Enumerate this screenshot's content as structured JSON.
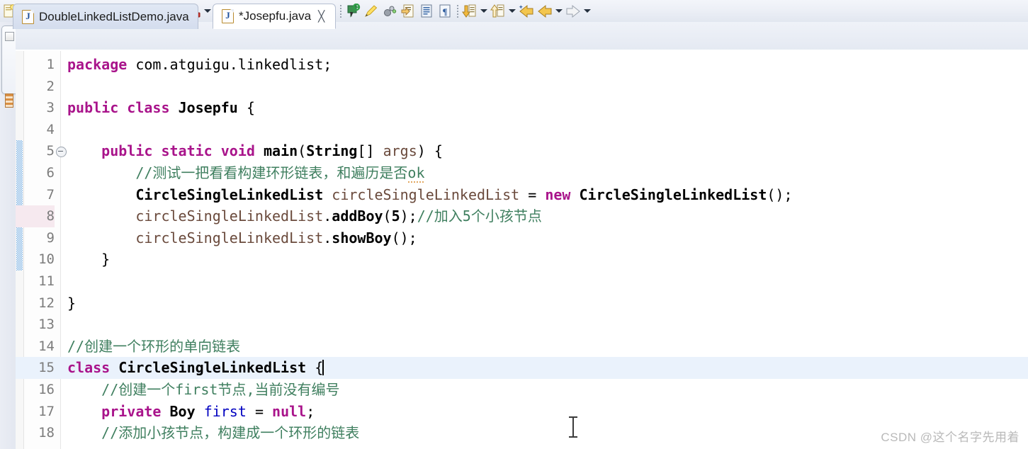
{
  "toolbar": {
    "items": [
      {
        "name": "new-wizard-icon",
        "glyph": "new",
        "dropdown": true
      },
      {
        "sep": true
      },
      {
        "name": "save-icon",
        "glyph": "save",
        "dropdown": false
      },
      {
        "name": "save-all-icon",
        "glyph": "save-all",
        "dropdown": false
      },
      {
        "sep": true
      },
      {
        "name": "console-icon",
        "glyph": "console",
        "dropdown": false
      },
      {
        "sep": true
      },
      {
        "name": "skip-breakpoints-icon",
        "glyph": "skip-bp",
        "dropdown": false
      },
      {
        "sep": true
      },
      {
        "name": "debug-icon",
        "glyph": "debug",
        "dropdown": true
      },
      {
        "name": "run-icon",
        "glyph": "run",
        "dropdown": true
      },
      {
        "name": "run-coverage-icon",
        "glyph": "coverage",
        "dropdown": true
      },
      {
        "sep": true
      },
      {
        "name": "new-java-package-icon",
        "glyph": "package",
        "dropdown": false
      },
      {
        "name": "new-class-icon",
        "glyph": "class",
        "dropdown": true
      },
      {
        "sep": true
      },
      {
        "name": "open-type-icon",
        "glyph": "open-type",
        "dropdown": false
      },
      {
        "name": "open-task-icon",
        "glyph": "open-task",
        "dropdown": false
      },
      {
        "name": "search-icon",
        "glyph": "pencil",
        "dropdown": true
      },
      {
        "sep": true
      },
      {
        "name": "debug-last-icon",
        "glyph": "annotate",
        "dropdown": false
      },
      {
        "name": "marker-icon",
        "glyph": "highlighter",
        "dropdown": false
      },
      {
        "name": "external-tools-icon",
        "glyph": "tools",
        "dropdown": false
      },
      {
        "name": "next-annotation-icon",
        "glyph": "next-edit",
        "dropdown": false
      },
      {
        "name": "show-whitespace-icon",
        "glyph": "whitespace",
        "dropdown": false
      },
      {
        "name": "paragraph-icon",
        "glyph": "paragraph",
        "dropdown": false
      },
      {
        "sep": true
      },
      {
        "name": "next-annotation-down-icon",
        "glyph": "down-annot",
        "dropdown": true
      },
      {
        "name": "previous-annotation-up-icon",
        "glyph": "up-annot",
        "dropdown": true
      },
      {
        "name": "back-to-icon",
        "glyph": "back-star",
        "dropdown": false
      },
      {
        "name": "back-icon",
        "glyph": "back",
        "dropdown": true
      },
      {
        "name": "forward-icon",
        "glyph": "forward",
        "dropdown": true
      }
    ]
  },
  "tabs": [
    {
      "label": "DoubleLinkedListDemo.java",
      "active": false,
      "dirty": false,
      "closable": false
    },
    {
      "label": "*Josepfu.java",
      "active": true,
      "dirty": true,
      "closable": true
    }
  ],
  "editor": {
    "active_line": 15,
    "caret_line": 15,
    "changed_lines": [
      5,
      6,
      7,
      8,
      9,
      10
    ],
    "marked_line": 8,
    "folding_line": 5,
    "lines": [
      {
        "n": "1",
        "tokens": [
          {
            "t": "package",
            "c": "kw"
          },
          {
            "t": " com.atguigu.linkedlist;",
            "c": ""
          }
        ]
      },
      {
        "n": "2",
        "tokens": []
      },
      {
        "n": "3",
        "tokens": [
          {
            "t": "public",
            "c": "kw"
          },
          {
            "t": " ",
            "c": ""
          },
          {
            "t": "class",
            "c": "kw"
          },
          {
            "t": " ",
            "c": ""
          },
          {
            "t": "Josepfu",
            "c": "typ"
          },
          {
            "t": " {",
            "c": ""
          }
        ]
      },
      {
        "n": "4",
        "tokens": []
      },
      {
        "n": "5",
        "tokens": [
          {
            "t": "    ",
            "c": ""
          },
          {
            "t": "public",
            "c": "kw"
          },
          {
            "t": " ",
            "c": ""
          },
          {
            "t": "static",
            "c": "kw"
          },
          {
            "t": " ",
            "c": ""
          },
          {
            "t": "void",
            "c": "kw"
          },
          {
            "t": " ",
            "c": ""
          },
          {
            "t": "main",
            "c": "mth"
          },
          {
            "t": "(",
            "c": ""
          },
          {
            "t": "String",
            "c": "typ"
          },
          {
            "t": "[] ",
            "c": ""
          },
          {
            "t": "args",
            "c": "loc"
          },
          {
            "t": ") {",
            "c": ""
          }
        ]
      },
      {
        "n": "6",
        "tokens": [
          {
            "t": "        ",
            "c": ""
          },
          {
            "t": "//测试一把看看构建环形链表，和遍历是否",
            "c": "cmt"
          },
          {
            "t": "ok",
            "c": "cmt squig"
          }
        ]
      },
      {
        "n": "7",
        "tokens": [
          {
            "t": "        ",
            "c": ""
          },
          {
            "t": "CircleSingleLinkedList",
            "c": "typ"
          },
          {
            "t": " ",
            "c": ""
          },
          {
            "t": "circleSingleLinkedList",
            "c": "loc"
          },
          {
            "t": " = ",
            "c": ""
          },
          {
            "t": "new",
            "c": "kw"
          },
          {
            "t": " ",
            "c": ""
          },
          {
            "t": "CircleSingleLinkedList",
            "c": "typ"
          },
          {
            "t": "();",
            "c": ""
          }
        ]
      },
      {
        "n": "8",
        "tokens": [
          {
            "t": "        ",
            "c": ""
          },
          {
            "t": "circleSingleLinkedList",
            "c": "loc"
          },
          {
            "t": ".",
            "c": ""
          },
          {
            "t": "addBoy",
            "c": "mth"
          },
          {
            "t": "(",
            "c": ""
          },
          {
            "t": "5",
            "c": "num"
          },
          {
            "t": ");",
            "c": ""
          },
          {
            "t": "//加入5个小孩节点",
            "c": "cmt"
          }
        ]
      },
      {
        "n": "9",
        "tokens": [
          {
            "t": "        ",
            "c": ""
          },
          {
            "t": "circleSingleLinkedList",
            "c": "loc"
          },
          {
            "t": ".",
            "c": ""
          },
          {
            "t": "showBoy",
            "c": "mth"
          },
          {
            "t": "();",
            "c": ""
          }
        ]
      },
      {
        "n": "10",
        "tokens": [
          {
            "t": "    }",
            "c": ""
          }
        ]
      },
      {
        "n": "11",
        "tokens": []
      },
      {
        "n": "12",
        "tokens": [
          {
            "t": "}",
            "c": ""
          }
        ]
      },
      {
        "n": "13",
        "tokens": []
      },
      {
        "n": "14",
        "tokens": [
          {
            "t": "//创建一个环形的单向链表",
            "c": "cmt"
          }
        ]
      },
      {
        "n": "15",
        "tokens": [
          {
            "t": "class",
            "c": "kw"
          },
          {
            "t": " ",
            "c": ""
          },
          {
            "t": "CircleSingleLinkedList",
            "c": "typ"
          },
          {
            "t": " {",
            "c": ""
          }
        ],
        "caret": true
      },
      {
        "n": "16",
        "tokens": [
          {
            "t": "    ",
            "c": ""
          },
          {
            "t": "//创建一个first节点,当前没有编号",
            "c": "cmt"
          }
        ]
      },
      {
        "n": "17",
        "tokens": [
          {
            "t": "    ",
            "c": ""
          },
          {
            "t": "private",
            "c": "kw"
          },
          {
            "t": " ",
            "c": ""
          },
          {
            "t": "Boy",
            "c": "typ"
          },
          {
            "t": " ",
            "c": ""
          },
          {
            "t": "first",
            "c": "fld"
          },
          {
            "t": " = ",
            "c": ""
          },
          {
            "t": "null",
            "c": "kw"
          },
          {
            "t": ";",
            "c": ""
          }
        ]
      },
      {
        "n": "18",
        "tokens": [
          {
            "t": "    ",
            "c": ""
          },
          {
            "t": "//添加小孩节点，构建成一个环形的链表",
            "c": "cmt"
          }
        ]
      }
    ]
  },
  "watermark": {
    "text": "CSDN @这个名字先用着"
  },
  "colors": {
    "keyword": "#a9148b",
    "comment": "#3f7f5f",
    "field": "#0000c0",
    "local_variable": "#6a4a3c",
    "current_line_highlight": "#eaf2fc",
    "change_bar": "#7fb3e3",
    "marked_line_number": "#f6e9ef",
    "toolbar_background": "#e9edf5",
    "active_tab_background": "#ffffff",
    "inactive_tab_background": "#d9e1f0"
  }
}
